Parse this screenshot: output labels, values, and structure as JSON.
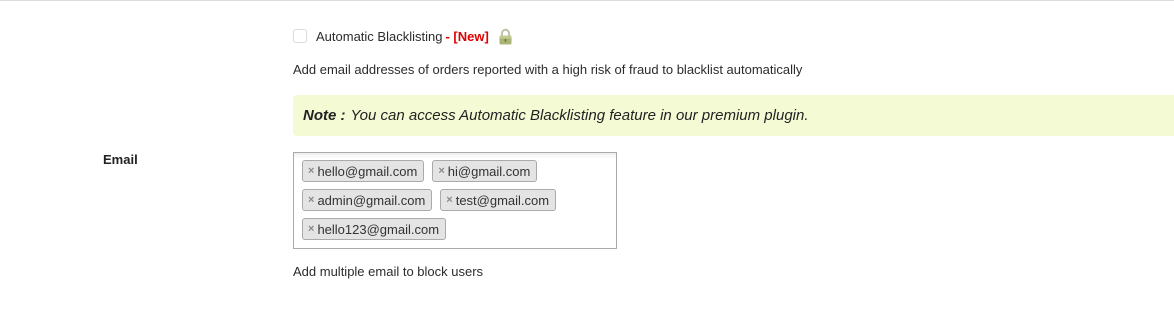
{
  "automatic_blacklisting": {
    "checked": false,
    "label": "Automatic Blacklisting",
    "badge": "- [New]",
    "icon": "lock-icon",
    "description": "Add email addresses of orders reported with a high risk of fraud to blacklist automatically"
  },
  "note": {
    "label": "Note :",
    "text": "You can access Automatic Blacklisting feature in our premium plugin."
  },
  "email_field": {
    "label": "Email",
    "remove_glyph": "×",
    "tags": [
      "hello@gmail.com",
      "hi@gmail.com",
      "admin@gmail.com",
      "test@gmail.com",
      "hello123@gmail.com"
    ],
    "help": "Add multiple email to block users"
  },
  "colors": {
    "badge": "#e00000",
    "note_background": "#f4fbd4",
    "tag_background": "#e4e4e4"
  }
}
